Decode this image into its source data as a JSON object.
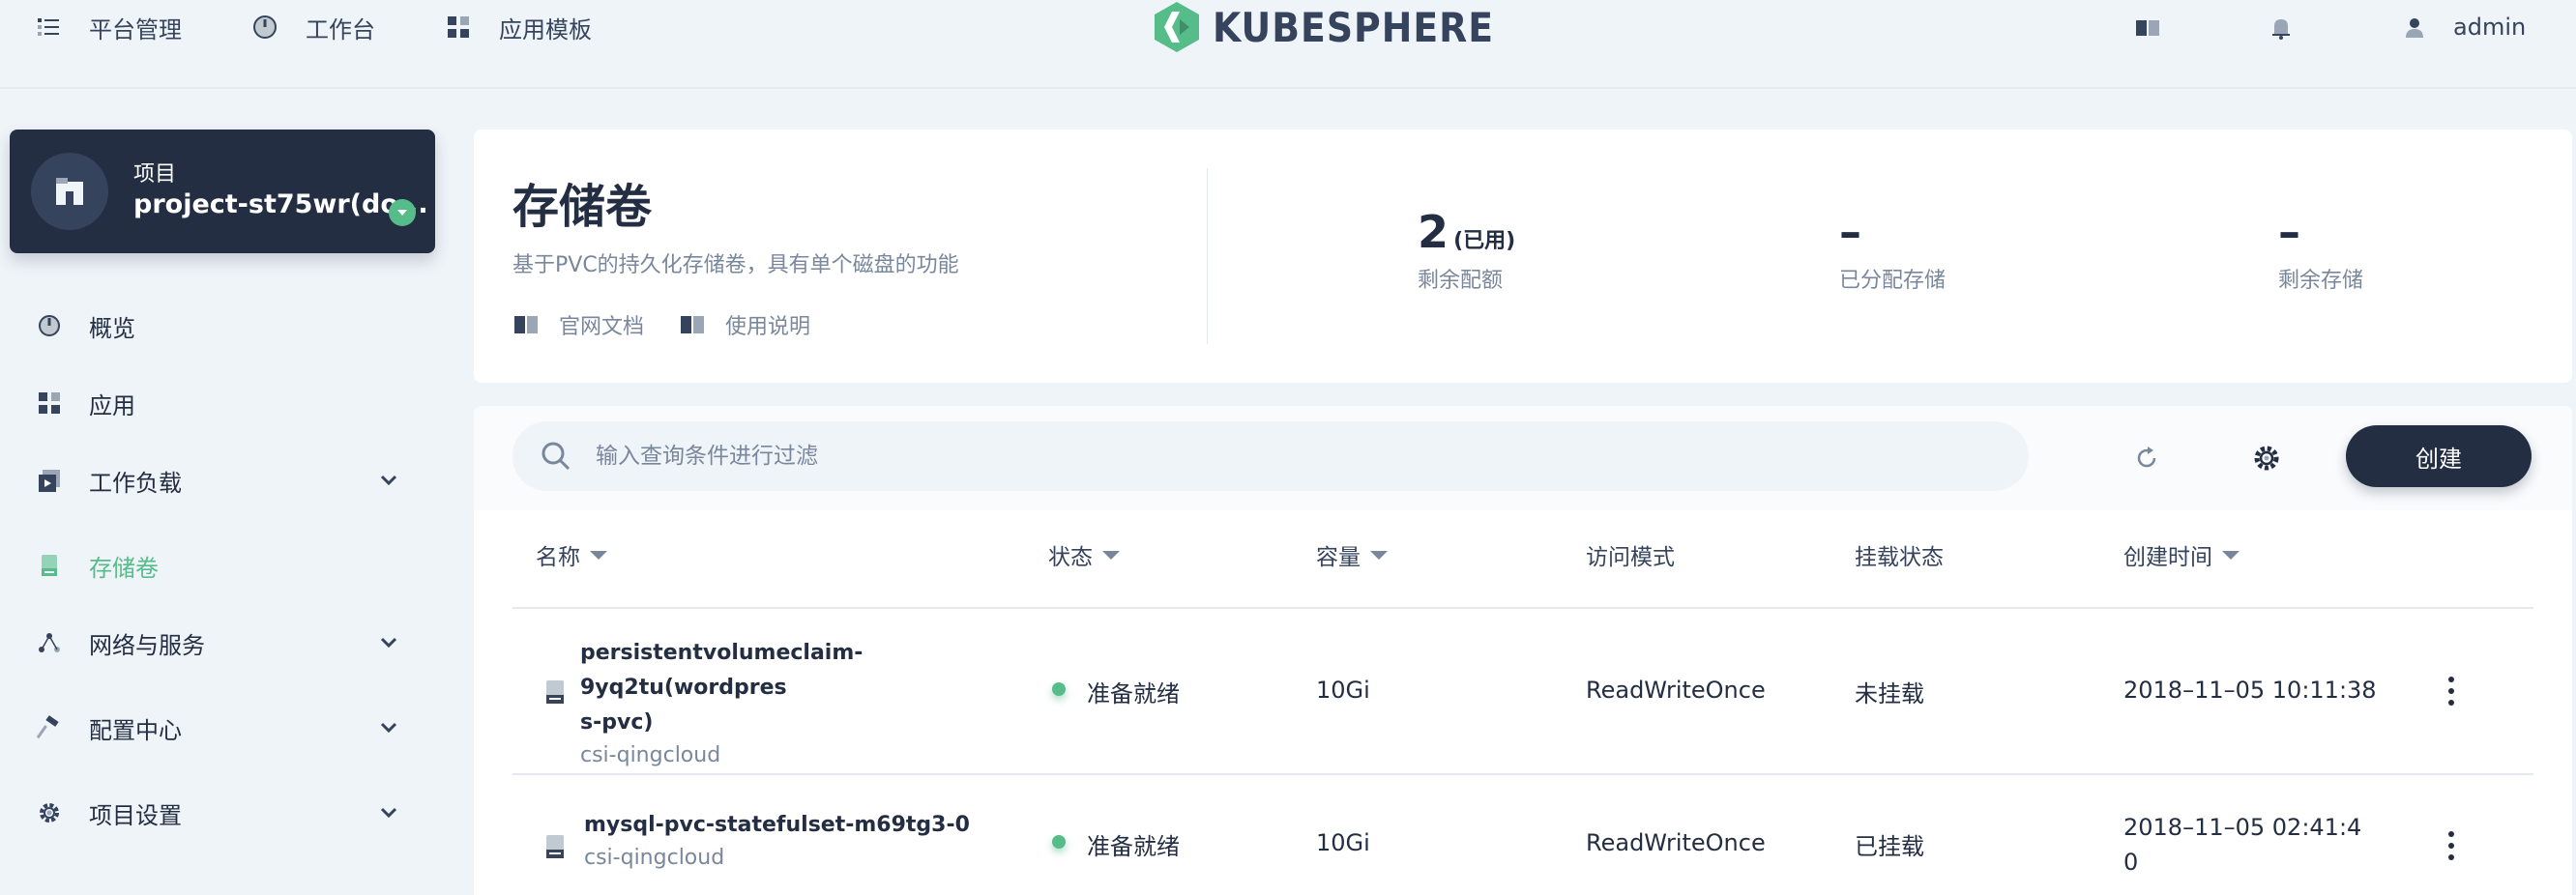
{
  "topbar": {
    "nav": [
      {
        "label": "平台管理",
        "icon": "list-icon"
      },
      {
        "label": "工作台",
        "icon": "dashboard-icon"
      },
      {
        "label": "应用模板",
        "icon": "apps-icon"
      }
    ],
    "logo_text": "KUBESPHERE",
    "user": "admin"
  },
  "sidebar": {
    "project_label": "项目",
    "project_name": "project-st75wr(do...",
    "items": [
      {
        "label": "概览",
        "icon": "dashboard-icon",
        "has_chevron": false,
        "active": false
      },
      {
        "label": "应用",
        "icon": "apps-icon",
        "has_chevron": false,
        "active": false
      },
      {
        "label": "工作负载",
        "icon": "workload-icon",
        "has_chevron": true,
        "active": false
      },
      {
        "label": "存储卷",
        "icon": "storage-icon",
        "has_chevron": false,
        "active": true
      },
      {
        "label": "网络与服务",
        "icon": "network-icon",
        "has_chevron": true,
        "active": false
      },
      {
        "label": "配置中心",
        "icon": "hammer-icon",
        "has_chevron": true,
        "active": false
      },
      {
        "label": "项目设置",
        "icon": "gear-icon",
        "has_chevron": true,
        "active": false
      }
    ]
  },
  "header": {
    "title": "存储卷",
    "description": "基于PVC的持久化存储卷，具有单个磁盘的功能",
    "links": [
      "官网文档",
      "使用说明"
    ],
    "stats": [
      {
        "value": "2",
        "suffix": "(已用)",
        "label": "剩余配额"
      },
      {
        "value": "–",
        "suffix": "",
        "label": "已分配存储"
      },
      {
        "value": "–",
        "suffix": "",
        "label": "剩余存储"
      }
    ]
  },
  "toolbar": {
    "search_placeholder": "输入查询条件进行过滤",
    "create_label": "创建"
  },
  "table": {
    "columns": [
      {
        "label": "名称",
        "sortable": true
      },
      {
        "label": "状态",
        "sortable": true
      },
      {
        "label": "容量",
        "sortable": true
      },
      {
        "label": "访问模式",
        "sortable": false
      },
      {
        "label": "挂载状态",
        "sortable": false
      },
      {
        "label": "创建时间",
        "sortable": true
      }
    ],
    "rows": [
      {
        "name_line1": "persistentvolumeclaim-9yq2tu(wordpres",
        "name_line2": "s-pvc)",
        "storage_class": "csi-qingcloud",
        "status": "准备就绪",
        "capacity": "10Gi",
        "access_mode": "ReadWriteOnce",
        "mount_status": "未挂载",
        "created_line1": "2018–11–05 10:11:38",
        "created_line2": ""
      },
      {
        "name_line1": "mysql-pvc-statefulset-m69tg3-0",
        "name_line2": "",
        "storage_class": "csi-qingcloud",
        "status": "准备就绪",
        "capacity": "10Gi",
        "access_mode": "ReadWriteOnce",
        "mount_status": "已挂载",
        "created_line1": "2018–11–05 02:41:4",
        "created_line2": "0"
      }
    ]
  },
  "colors": {
    "accent": "#55bc8a",
    "dark": "#242e42",
    "muted": "#79879c",
    "background": "#eff4f9"
  }
}
